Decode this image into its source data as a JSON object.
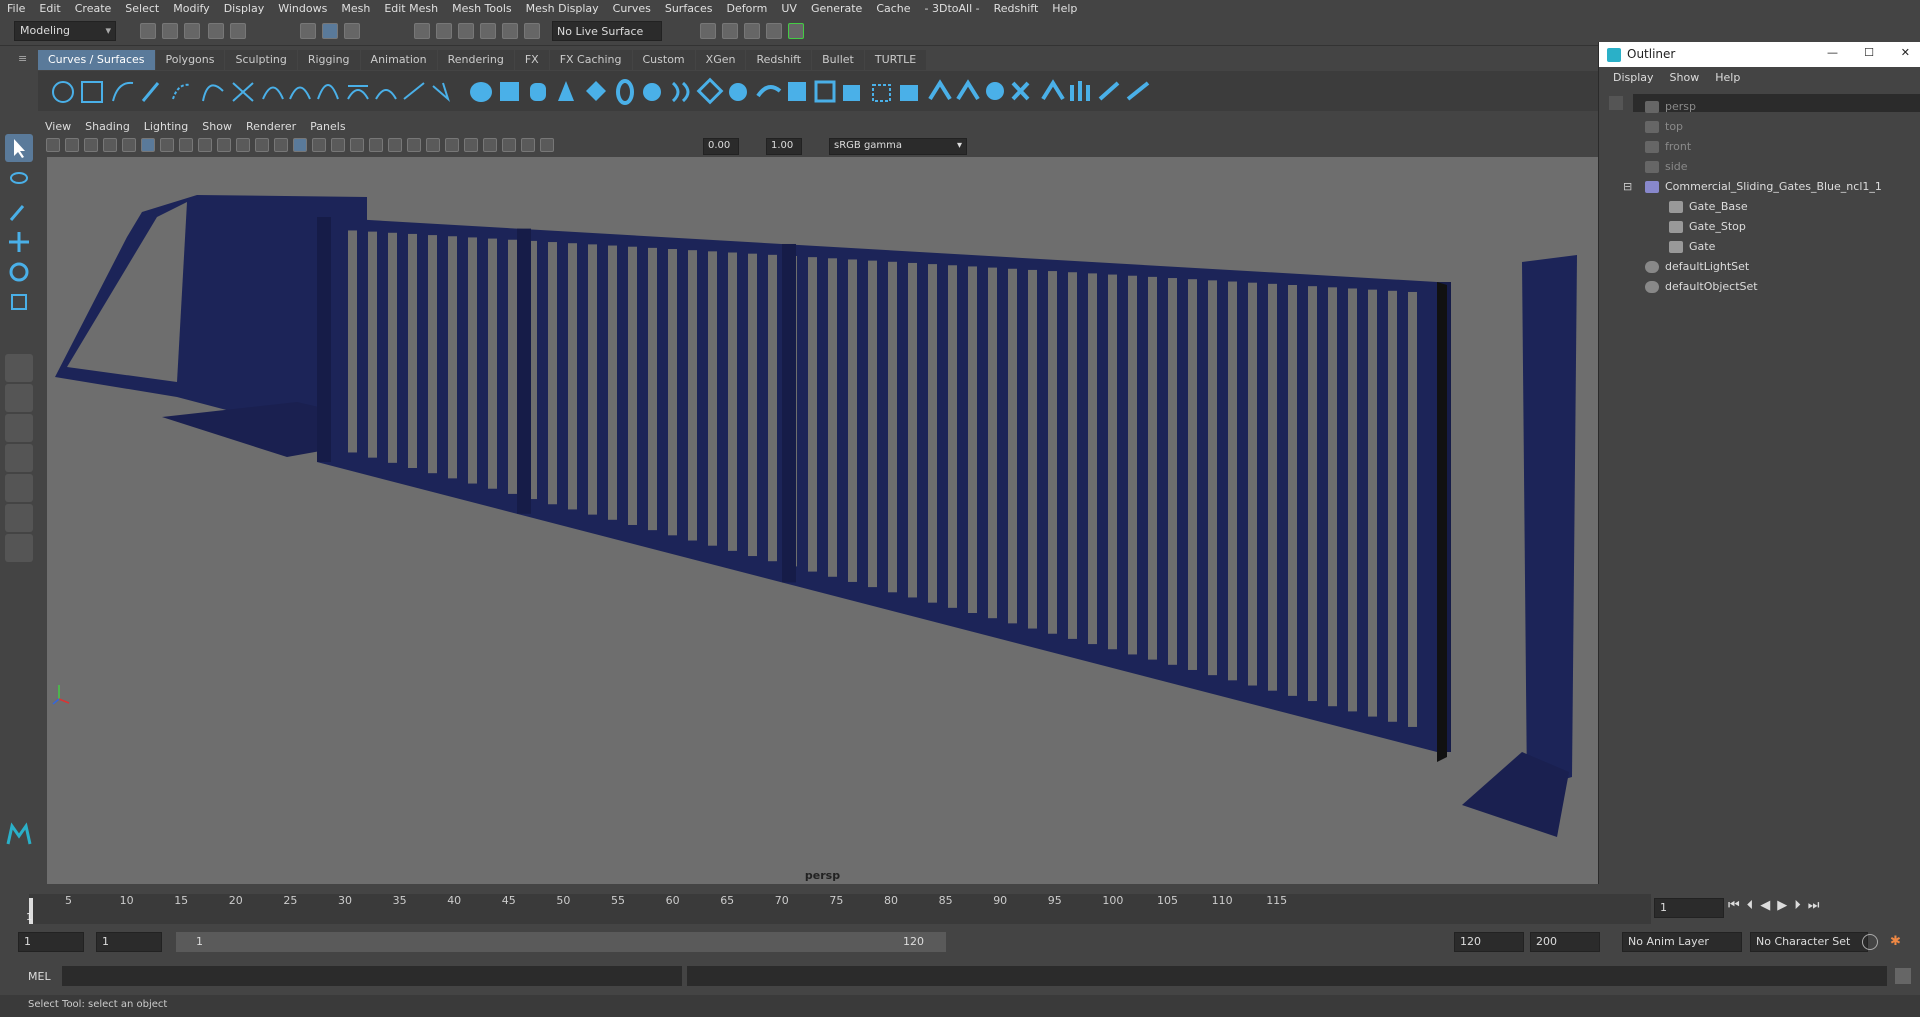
{
  "menubar": [
    "File",
    "Edit",
    "Create",
    "Select",
    "Modify",
    "Display",
    "Windows",
    "Mesh",
    "Edit Mesh",
    "Mesh Tools",
    "Mesh Display",
    "Curves",
    "Surfaces",
    "Deform",
    "UV",
    "Generate",
    "Cache",
    "- 3DtoAll -",
    "Redshift",
    "Help"
  ],
  "statusline": {
    "workspace": "Modeling",
    "live_surface": "No Live Surface"
  },
  "shelf_tabs": [
    "Curves / Surfaces",
    "Polygons",
    "Sculpting",
    "Rigging",
    "Animation",
    "Rendering",
    "FX",
    "FX Caching",
    "Custom",
    "XGen",
    "Redshift",
    "Bullet",
    "TURTLE"
  ],
  "viewport": {
    "menu": [
      "View",
      "Shading",
      "Lighting",
      "Show",
      "Renderer",
      "Panels"
    ],
    "exposure": "0.00",
    "gamma": "1.00",
    "color_space": "sRGB gamma",
    "camera_label": "persp"
  },
  "outliner": {
    "title": "Outliner",
    "menu": [
      "Display",
      "Show",
      "Help"
    ],
    "items": [
      {
        "label": "persp",
        "type": "camera"
      },
      {
        "label": "top",
        "type": "camera"
      },
      {
        "label": "front",
        "type": "camera"
      },
      {
        "label": "side",
        "type": "camera"
      },
      {
        "label": "Commercial_Sliding_Gates_Blue_ncl1_1",
        "type": "group"
      },
      {
        "label": "Gate_Base",
        "type": "mesh"
      },
      {
        "label": "Gate_Stop",
        "type": "mesh"
      },
      {
        "label": "Gate",
        "type": "mesh"
      },
      {
        "label": "defaultLightSet",
        "type": "set"
      },
      {
        "label": "defaultObjectSet",
        "type": "set"
      }
    ]
  },
  "timeline": {
    "ticks": [
      "5",
      "10",
      "15",
      "20",
      "25",
      "30",
      "35",
      "40",
      "45",
      "50",
      "55",
      "60",
      "65",
      "70",
      "75",
      "80",
      "85",
      "90",
      "95",
      "100",
      "105",
      "110",
      "115"
    ],
    "current_frame_marker": "1",
    "current_frame": "1"
  },
  "range": {
    "start": "1",
    "playback_start": "1",
    "slider_start": "1",
    "slider_end": "120",
    "playback_end": "120",
    "end": "200",
    "anim_layer": "No Anim Layer",
    "character_set": "No Character Set"
  },
  "cmdline": {
    "lang": "MEL"
  },
  "help_text": "Select Tool: select an object",
  "colors": {
    "accent": "#5a7a9a",
    "gate": "#1c2458",
    "viewport_bg": "#6e6e6e",
    "panel": "#444444"
  }
}
